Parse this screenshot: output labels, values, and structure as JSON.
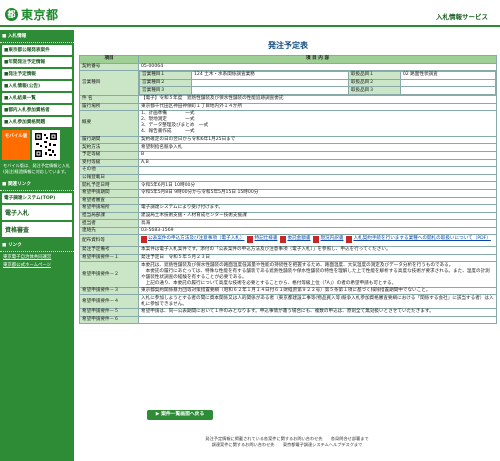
{
  "header": {
    "logo_mark": "都",
    "site_name": "東京都",
    "service_name": "入札情報サービス"
  },
  "sidebar": {
    "menu_heading": "■ 入札情報",
    "items": [
      "■東京都公報発表案件",
      "■年間発注予定情報",
      "■発注予定情報",
      "■入札情報(公告)",
      "■入札結果一覧",
      "■都内入札参加資格者",
      "■入札参加資格問題"
    ],
    "mobile_orange": "モバイル版",
    "mobile_text": "モバイル版は、発注予定情報と入札(発注)経過情報に対応しています。",
    "links_heading": "■ 関連リンク",
    "links": [
      "電子調達システム(TOP)",
      "電子入札",
      "資格審査"
    ],
    "links2_heading": "■ リンク",
    "links2": [
      "東京電子自治体共同運営",
      "東京都公式ホームページ"
    ]
  },
  "page_title": "発注予定表",
  "table": {
    "col_item": "項目",
    "col_content": "項 目 内 容",
    "rows": [
      {
        "label": "契約番号",
        "value": "05-00064"
      },
      {
        "label": "営業種目",
        "kind": "eigyo"
      },
      {
        "label": "件 名",
        "value": "【電子】令和５年度　遮熱性舗装及び保水性舗装の性能追跡調査委託"
      },
      {
        "label": "履行場所",
        "value": "東京都千代田区神田神保町１丁目地内外１４か所"
      },
      {
        "label": "概要",
        "value": "1、計画準備　　　　一式\n2、現地測定　　　　一式\n3、データ整理及びまとめ　一式\n4、報告書作成　　　一式"
      },
      {
        "label": "履行期間",
        "value": "契約確定の日の翌日から令和6年1月25日まで"
      },
      {
        "label": "契約方法",
        "value": "希望制指名競争入札"
      },
      {
        "label": "予定等級",
        "value": "B"
      },
      {
        "label": "受付等級",
        "value": "A,B"
      },
      {
        "label": "その他",
        "value": ""
      },
      {
        "label": "公報登載日",
        "value": ""
      },
      {
        "label": "開札予定日時",
        "value": "令和5年6月1日 10時00分"
      },
      {
        "label": "希望申請期間",
        "value": "令和5年5月8日 9時00分から令和5年5月15日 15時00分"
      },
      {
        "label": "希望者審査",
        "value": ""
      },
      {
        "label": "希望申請場所",
        "value": "電子調達システムにより受け付けます。"
      },
      {
        "label": "担当局部課",
        "value": "建設局土木技術支援・人材育成センター技術支援課"
      },
      {
        "label": "担当者",
        "value": "鳥海"
      },
      {
        "label": "連絡先",
        "value": "03-5683-1569"
      },
      {
        "label": "配布資料等",
        "kind": "docs"
      },
      {
        "label": "発注予定備考",
        "value": "本案件は電子入札案件です。添付の「公表案件の申込方法及び注意事項（電子入札）」を参照し、申込を行ってください。"
      },
      {
        "label": "希望申請要件－１",
        "value": "発注予定日　令和５年５月２３日"
      },
      {
        "label": "希望申請要件－２",
        "value": "本委託は、遮熱性舗装及び保水性舗装の路面温度低減量や性能の持続性を把握するため、路面温度、大気温度の測定及びデータ分析を行うものである。\n　本委託の履行にあたっては、特殊な性能を有する舗装である遮熱性舗装や保水性舗装の特性を理解した上で性能を解析する高度な技術が要求される。また、温度の計測や舗装性状調査の経験を有することが必要である。\n　上記の通り、本委託の履行について高度な技術を必要とすることから、格付等級上位（「A」）の者の希望申請も可とする。"
      },
      {
        "label": "希望申請要件－３",
        "value": "東京都契約関係暴力団等対策措置要綱（昭和６２年１月１４日付６１財経庶第９２２号）第５条第１項に基づく排除措置期間中でないこと。"
      },
      {
        "label": "希望申請要件－４",
        "value": "入札に参加しようとする者の間に資本関係又は人的関係がある者（東京都建設工事等(物品買入等)競争入札参加資格審査要綱における「関係する会社」に該当する者）は入札に参加できません。"
      },
      {
        "label": "希望申請要件－５",
        "value": "希望申請は、同一公表期間において１件のみとなります。申込事情が遭う場合にも、複数の申込は、原則全て無効扱いとさせていただきます。"
      },
      {
        "label": "希望申請要件－６",
        "value": ""
      }
    ],
    "eigyo": {
      "rows": [
        {
          "label": "営業種目１",
          "value": "124 土木・水系関係調査業務",
          "label2": "取扱品目１",
          "value2": "02 路面性状調査"
        },
        {
          "label": "営業種目２",
          "value": "",
          "label2": "取扱品目２",
          "value2": ""
        },
        {
          "label": "営業種目３",
          "value": "",
          "label2": "取扱品目３",
          "value2": ""
        }
      ]
    },
    "docs": [
      "公表案件の申込方法及び注意事項（電子入札）",
      "特記仕様書",
      "委託金額書",
      "現況内訳書",
      "入札契約手続を行いまする業種への開札の取扱いについて（PDF）"
    ]
  },
  "back_button": "▶ 案件一覧画面へ戻る",
  "footer": {
    "line1": "発注予定情報に掲載されている各案件に関するお問い合わせ先　　各局問合せ部署まで",
    "line2": "調達案件に関するお問い合わせ先　　東京都電子調達システムヘルプデスクまで"
  },
  "colors": {
    "brand_green": "#2e8b36",
    "label_bg": "#cbe6c6",
    "header_bg": "#9fcf95",
    "title_blue": "#0f4c81"
  }
}
